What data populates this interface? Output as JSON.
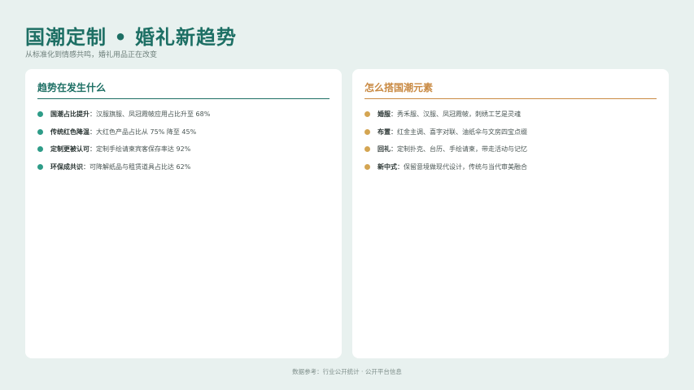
{
  "header": {
    "title": "国潮定制 • 婚礼新趋势",
    "subtitle": "从标准化到情感共鸣，婚礼用品正在改变"
  },
  "left_card": {
    "title": "趋势在发生什么",
    "items": [
      {
        "label": "国潮占比提升",
        "text": "汉服旗服、凤冠霞帔应用占比升至 68%"
      },
      {
        "label": "传统红色降温",
        "text": "大红色产品占比从 75% 降至 45%"
      },
      {
        "label": "定制更被认可",
        "text": "定制手绘请柬宾客保存率达 92%"
      },
      {
        "label": "环保成共识",
        "text": "可降解纸品与租赁道具占比达 62%"
      }
    ]
  },
  "right_card": {
    "title": "怎么搭国潮元素",
    "items": [
      {
        "label": "婚服",
        "text": "秀禾服、汉服、凤冠霞帔，刺绣工艺是灵魂"
      },
      {
        "label": "布置",
        "text": "红金主调、喜字对联、油纸伞与文房四宝点缀"
      },
      {
        "label": "回礼",
        "text": "定制扑克、台历、手绘请柬，带走活动与记忆"
      },
      {
        "label": "新中式",
        "text": "保留意境做现代设计，传统与当代审美融合"
      }
    ]
  },
  "footer": {
    "text": "数据参考：行业公开统计 · 公开平台信息"
  },
  "colors": {
    "primary": "#1d6f64",
    "accent": "#c98a43",
    "background": "#e8f1ef"
  }
}
